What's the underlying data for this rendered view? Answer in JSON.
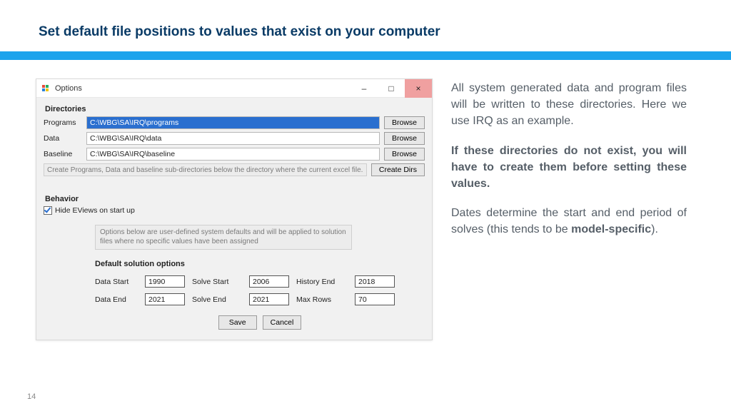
{
  "slide": {
    "title": "Set default file positions to values that exist on your computer",
    "page_number": "14"
  },
  "window": {
    "title": "Options",
    "buttons": {
      "minimize": "–",
      "maximize": "□",
      "close": "×"
    },
    "directories": {
      "header": "Directories",
      "rows": [
        {
          "label": "Programs",
          "value": "C:\\WBG\\SA\\IRQ\\programs",
          "browse": "Browse"
        },
        {
          "label": "Data",
          "value": "C:\\WBG\\SA\\IRQ\\data",
          "browse": "Browse"
        },
        {
          "label": "Baseline",
          "value": "C:\\WBG\\SA\\IRQ\\baseline",
          "browse": "Browse"
        }
      ],
      "hint": "Create Programs, Data and baseline sub-directories below the directory where the current excel file.",
      "create_btn": "Create Dirs"
    },
    "behavior": {
      "header": "Behavior",
      "hide_eviews": "Hide EViews on start up",
      "note": "Options below are user-defined system defaults and will be applied to solution files where no specific values have been assigned"
    },
    "defaults": {
      "header": "Default solution options",
      "labels": {
        "data_start": "Data Start",
        "data_end": "Data End",
        "solve_start": "Solve Start",
        "solve_end": "Solve End",
        "history_end": "History End",
        "max_rows": "Max Rows"
      },
      "values": {
        "data_start": "1990",
        "data_end": "2021",
        "solve_start": "2006",
        "solve_end": "2021",
        "history_end": "2018",
        "max_rows": "70"
      },
      "save": "Save",
      "cancel": "Cancel"
    }
  },
  "text": {
    "p1": "All system generated data and program files will be written to these directories. Here we use IRQ as an example.",
    "p2": "If these directories do not exist, you will have to create them before setting these values.",
    "p3a": "Dates determine the start and end period of solves (this tends to be ",
    "p3b": "model-specific",
    "p3c": ")."
  }
}
